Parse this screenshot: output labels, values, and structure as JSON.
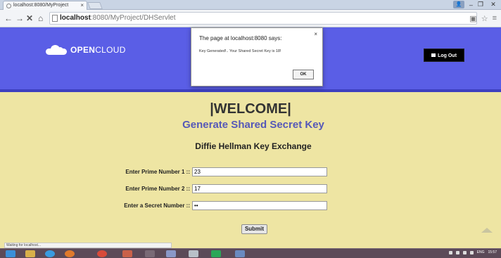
{
  "browser": {
    "tab_title": "localhost:8080/MyProject",
    "tab_close": "×",
    "url_host": "localhost",
    "url_rest": ":8080/MyProject/DHServlet",
    "nav_back": "←",
    "nav_forward": "→",
    "nav_stop": "✕",
    "nav_home": "⌂",
    "status": "Waiting for localhost..."
  },
  "header": {
    "logo_bold": "OPEN",
    "logo_light": "CLOUD",
    "logout_label": "Log Out"
  },
  "dialog": {
    "title": "The page at localhost:8080 says:",
    "close": "×",
    "message": "Key Generated!.. Your Shared Secret Key is 18!",
    "ok_label": "OK"
  },
  "main": {
    "welcome": "|WELCOME|",
    "subtitle": "Generate Shared Secret Key",
    "heading": "Diffie Hellman Key Exchange",
    "fields": [
      {
        "label": "Enter Prime Number 1 ::",
        "value": "23"
      },
      {
        "label": "Enter Prime Number 2 ::",
        "value": "17"
      },
      {
        "label": "Enter a Secret Number ::",
        "value": "••"
      }
    ],
    "submit_label": "Submit"
  },
  "taskbar": {
    "time": "15:57",
    "lang": "ENG"
  },
  "colors": {
    "header_bg": "#5a5ee6",
    "page_bg": "#eee5a3",
    "subtitle": "#5558b8"
  }
}
